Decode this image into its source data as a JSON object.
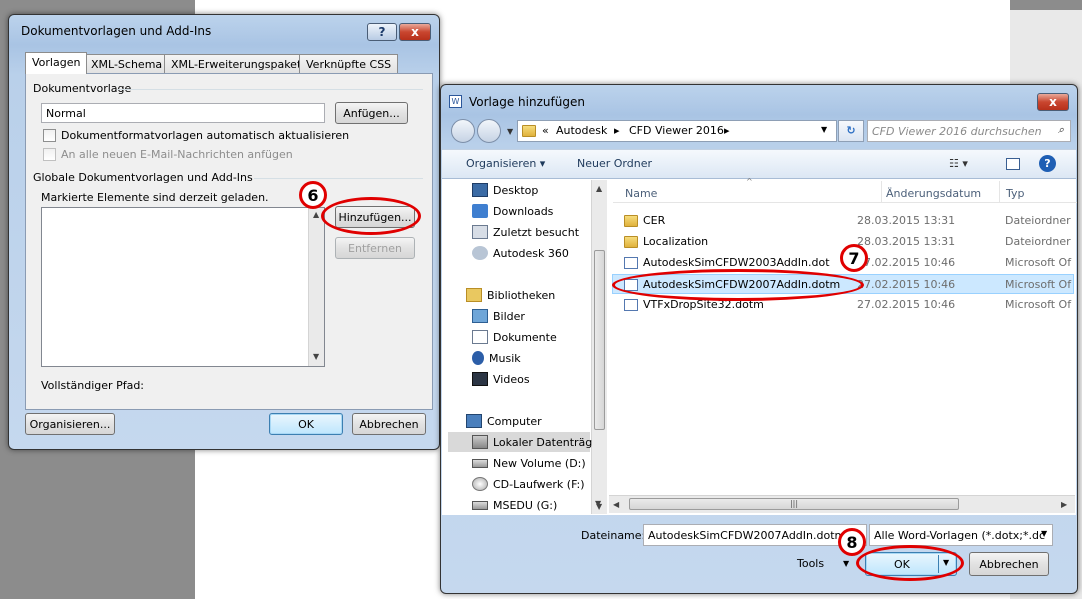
{
  "dialog1": {
    "title": "Dokumentvorlagen und Add-Ins",
    "help": "?",
    "close": "x",
    "tabs": [
      "Vorlagen",
      "XML-Schema",
      "XML-Erweiterungspakete",
      "Verknüpfte CSS"
    ],
    "doc_template_label": "Dokumentvorlage",
    "doc_template_value": "Normal",
    "attach_btn": "Anfügen...",
    "chk_auto_update": "Dokumentformatvorlagen automatisch aktualisieren",
    "chk_email": "An alle neuen E-Mail-Nachrichten anfügen",
    "global_label": "Globale Dokumentvorlagen und Add-Ins",
    "loaded_label": "Markierte Elemente sind derzeit geladen.",
    "add_btn": "Hinzufügen...",
    "remove_btn": "Entfernen",
    "full_path_label": "Vollständiger Pfad:",
    "organize_btn": "Organisieren...",
    "ok_btn": "OK",
    "cancel_btn": "Abbrechen"
  },
  "dialog2": {
    "title": "Vorlage hinzufügen",
    "close": "x",
    "breadcrumb": [
      "«",
      "Autodesk",
      "CFD Viewer 2016"
    ],
    "search_placeholder": "CFD Viewer 2016 durchsuchen",
    "toolbar": {
      "organize": "Organisieren ▾",
      "new_folder": "Neuer Ordner"
    },
    "tree": [
      {
        "label": "Desktop",
        "icon": "desktop-icon"
      },
      {
        "label": "Downloads",
        "icon": "downloads-icon"
      },
      {
        "label": "Zuletzt besucht",
        "icon": "recent-icon"
      },
      {
        "label": "Autodesk 360",
        "icon": "cloud-icon"
      },
      {
        "label": "Bibliotheken",
        "icon": "library-icon"
      },
      {
        "label": "Bilder",
        "icon": "pictures-icon"
      },
      {
        "label": "Dokumente",
        "icon": "documents-icon"
      },
      {
        "label": "Musik",
        "icon": "music-icon"
      },
      {
        "label": "Videos",
        "icon": "videos-icon"
      },
      {
        "label": "Computer",
        "icon": "computer-icon"
      },
      {
        "label": "Lokaler Datenträg",
        "icon": "drive-icon"
      },
      {
        "label": "New Volume (D:)",
        "icon": "drive-icon"
      },
      {
        "label": "CD-Laufwerk (F:)",
        "icon": "cd-icon"
      },
      {
        "label": "MSEDU (G:)",
        "icon": "drive-icon"
      }
    ],
    "columns": [
      "Name",
      "Änderungsdatum",
      "Typ"
    ],
    "files": [
      {
        "name": "CER",
        "date": "28.03.2015 13:31",
        "type": "Dateiordner",
        "kind": "folder"
      },
      {
        "name": "Localization",
        "date": "28.03.2015 13:31",
        "type": "Dateiordner",
        "kind": "folder"
      },
      {
        "name": "AutodeskSimCFDW2003AddIn.dot",
        "date": "27.02.2015 10:46",
        "type": "Microsoft Of",
        "kind": "doc"
      },
      {
        "name": "AutodeskSimCFDW2007AddIn.dotm",
        "date": "27.02.2015 10:46",
        "type": "Microsoft Of",
        "kind": "doc"
      },
      {
        "name": "VTFxDropSite32.dotm",
        "date": "27.02.2015 10:46",
        "type": "Microsoft Of",
        "kind": "doc"
      }
    ],
    "filename_label": "Dateiname:",
    "filename_value": "AutodeskSimCFDW2007AddIn.dotm",
    "filter_value": "Alle Word-Vorlagen (*.dotx;*.dc",
    "tools": "Tools",
    "ok_btn": "OK",
    "cancel_btn": "Abbrechen"
  },
  "markers": [
    "6",
    "7",
    "8"
  ],
  "colors": {
    "highlight_ring": "#e00000",
    "selected_row": "#cce8ff"
  }
}
